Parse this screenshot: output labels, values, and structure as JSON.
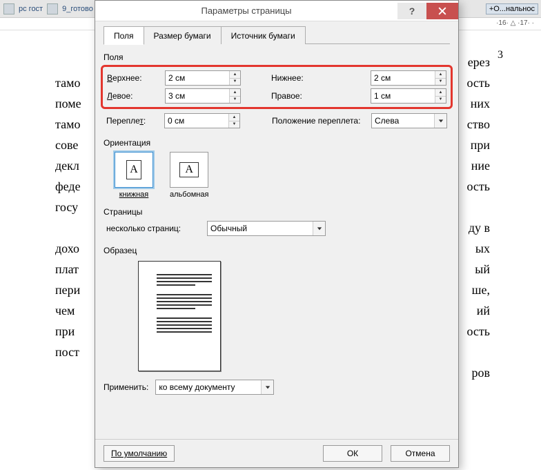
{
  "toolbar": {
    "doc1": "рс гост",
    "doc2": "9_готово",
    "rightBadge": "+О...нальнос"
  },
  "ruler": {
    "right_marks": "·16· △ ·17· ·"
  },
  "bg_doc": {
    "page_number": "3",
    "lines": [
      "",
      "",
      "",
      "",
      "                    ерез",
      "тамо                    ость",
      "поме                    них",
      "тамо                    ство",
      "сове                    при",
      "декл                    ние",
      "феде                    ость",
      "госу",
      "",
      "                    ду в",
      "дохо                    ых",
      "плат                    ый",
      "пери                    ше,",
      "чем                    ий",
      "при                    ость",
      "пост",
      "                    ров"
    ]
  },
  "dialog": {
    "title": "Параметры страницы",
    "tabs": {
      "fields": "Поля",
      "paper_size": "Размер бумаги",
      "paper_source": "Источник бумаги"
    },
    "section_fields": "Поля",
    "top_lbl": "Верхнее:",
    "top_lbl_u": "В",
    "top_val": "2 см",
    "bottom_lbl": "ижнее:",
    "bottom_lbl_u": "Н",
    "bottom_val": "2 см",
    "left_lbl": "евое:",
    "left_lbl_u": "Л",
    "left_val": "3 см",
    "right_lbl": "равое:",
    "right_lbl_u": "П",
    "right_val": "1 см",
    "gutter_lbl": "Перепле",
    "gutter_lbl_u": "т",
    "gutter_lbl_after": ":",
    "gutter_val": "0 см",
    "gutter_pos_lbl": "оложение переплета:",
    "gutter_pos_lbl_u": "П",
    "gutter_pos_val": "Слева",
    "section_orient": "Ориентация",
    "portrait": "книжная",
    "portrait_u": "к",
    "landscape": "альбомная",
    "landscape_u": "а",
    "section_pages": "Страницы",
    "multi_lbl": "не",
    "multi_lbl_u": "с",
    "multi_lbl_after": "колько страниц:",
    "multi_val": "Обычный",
    "section_sample": "Образец",
    "apply_lbl": "Применит",
    "apply_lbl_u": "ь",
    "apply_lbl_after": ":",
    "apply_val": "ко всему документу",
    "default_btn": "По умолчанию",
    "ok_btn": "ОК",
    "cancel_btn": "Отмена"
  }
}
